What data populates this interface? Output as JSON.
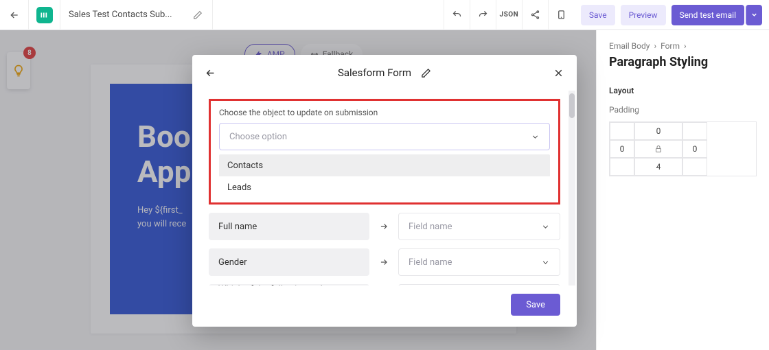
{
  "topbar": {
    "doc_title": "Sales Test Contacts Sub...",
    "json_label": "JSON",
    "save": "Save",
    "preview": "Preview",
    "send": "Send test email"
  },
  "idea": {
    "badge": "8"
  },
  "toggles": {
    "amp": "AMP",
    "fallback": "Fallback"
  },
  "hero": {
    "title_line1": "Boo",
    "title_line2": "App",
    "para_line1": "Hey ${first_",
    "para_line2": "you will rece"
  },
  "side": {
    "crumb1": "Email Body",
    "crumb2": "Form",
    "heading": "Paragraph Styling",
    "section": "Layout",
    "sub": "Padding",
    "top": "0",
    "left": "0",
    "right": "0",
    "bottom": "4"
  },
  "modal": {
    "title": "Salesform Form",
    "label": "Choose the object to update on submission",
    "placeholder": "Choose option",
    "options": [
      "Contacts",
      "Leads"
    ],
    "fields": [
      "Full name",
      "Gender",
      "Which of the following web browsers do"
    ],
    "field_placeholder": "Field name",
    "save": "Save"
  }
}
